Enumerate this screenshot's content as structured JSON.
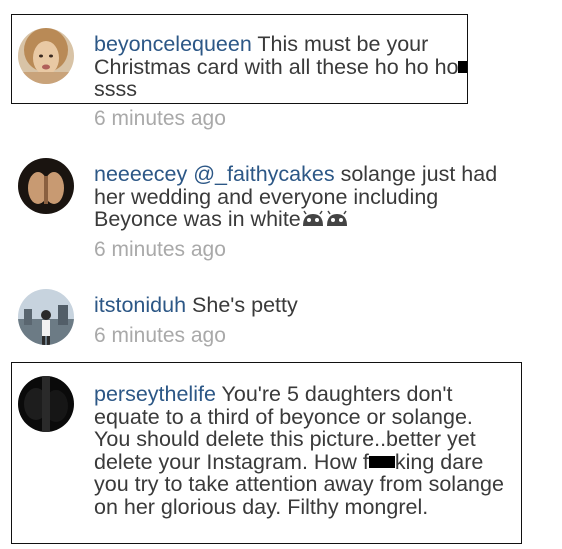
{
  "comments": [
    {
      "username": "beyoncelequeen",
      "text_a": "This must be your Christmas card with all these ho ho ho",
      "text_b": "ssss",
      "time": "6 minutes ago",
      "avatar_icon": "avatar-woman-blonde-icon"
    },
    {
      "username": "neeeecey",
      "mention": "@_faithycakes",
      "text": "solange just had her wedding and everyone including Beyonce was in white",
      "emoji_icon": "android-face-icon",
      "time": "6 minutes ago",
      "avatar_icon": "avatar-hands-icon"
    },
    {
      "username": "itstoniduh",
      "text": "She's petty",
      "time": "6 minutes ago",
      "avatar_icon": "avatar-city-icon"
    },
    {
      "username": "perseythelife",
      "text_a": "You're 5 daughters don't equate to a third of beyonce or solange. You should delete this picture..better yet delete your Instagram. How f",
      "text_b": "king dare you try to take attention away from solange on her glorious day. Filthy mongrel.",
      "avatar_icon": "avatar-dark-icon"
    }
  ],
  "colors": {
    "username": "#2c5786",
    "body_text": "#3a3a3a",
    "timestamp": "#a9a9a9",
    "highlight_border": "#111111"
  }
}
